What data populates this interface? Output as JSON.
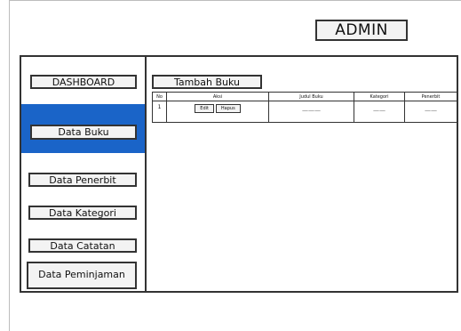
{
  "header": {
    "title": "ADMIN"
  },
  "sidebar": {
    "items": [
      {
        "label": "DASHBOARD"
      },
      {
        "label": "Data Buku"
      },
      {
        "label": "Data Penerbit"
      },
      {
        "label": "Data Kategori"
      },
      {
        "label": "Data Catatan"
      },
      {
        "label": "Data Peminjaman"
      }
    ],
    "active_item": "Data Buku",
    "active_color": "#1a64c8"
  },
  "main": {
    "add_button_label": "Tambah Buku",
    "table": {
      "columns": [
        "No",
        "Aksi",
        "Judul Buku",
        "Kategori",
        "Penerbit"
      ],
      "rows": [
        {
          "no": "1",
          "edit_label": "Edit",
          "delete_label": "Hapus",
          "judul": "———",
          "kategori": "——",
          "penerbit": "——"
        }
      ]
    }
  }
}
